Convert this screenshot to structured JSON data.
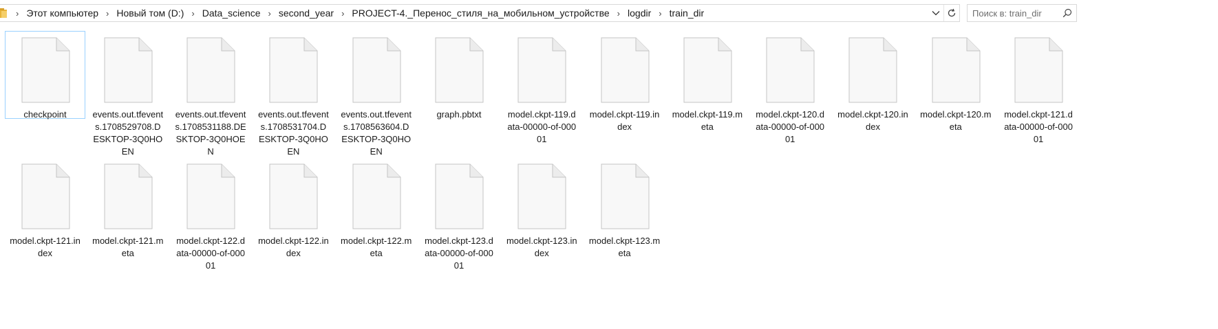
{
  "address_bar": {
    "breadcrumbs": [
      "Этот компьютер",
      "Новый том (D:)",
      "Data_science",
      "second_year",
      "PROJECT-4._Перенос_стиля_на_мобильном_устройстве",
      "logdir",
      "train_dir"
    ],
    "separator_icon": "chevron-right-icon",
    "dropdown_icon": "chevron-down-icon",
    "refresh_icon": "refresh-icon"
  },
  "search": {
    "placeholder": "Поиск в: train_dir",
    "value": "",
    "icon": "search-icon"
  },
  "files": {
    "row1": [
      "checkpoint",
      "events.out.tfevents.1708529708.DESKTOP-3Q0HOEN",
      "events.out.tfevents.1708531188.DESKTOP-3Q0HOEN",
      "events.out.tfevents.1708531704.DESKTOP-3Q0HOEN",
      "events.out.tfevents.1708563604.DESKTOP-3Q0HOEN",
      "graph.pbtxt",
      "model.ckpt-119.data-00000-of-00001",
      "model.ckpt-119.index",
      "model.ckpt-119.meta",
      "model.ckpt-120.data-00000-of-00001",
      "model.ckpt-120.index",
      "model.ckpt-120.meta",
      "model.ckpt-121.data-00000-of-00001"
    ],
    "row2": [
      "model.ckpt-121.index",
      "model.ckpt-121.meta",
      "model.ckpt-122.data-00000-of-00001",
      "model.ckpt-122.index",
      "model.ckpt-122.meta",
      "model.ckpt-123.data-00000-of-00001",
      "model.ckpt-123.index",
      "model.ckpt-123.meta"
    ],
    "selected": "checkpoint",
    "file_icon": "generic-file-icon"
  },
  "colors": {
    "selection_border": "#99d1ff",
    "folder_yellow": "#e8b43a",
    "border": "#d9d9d9"
  }
}
